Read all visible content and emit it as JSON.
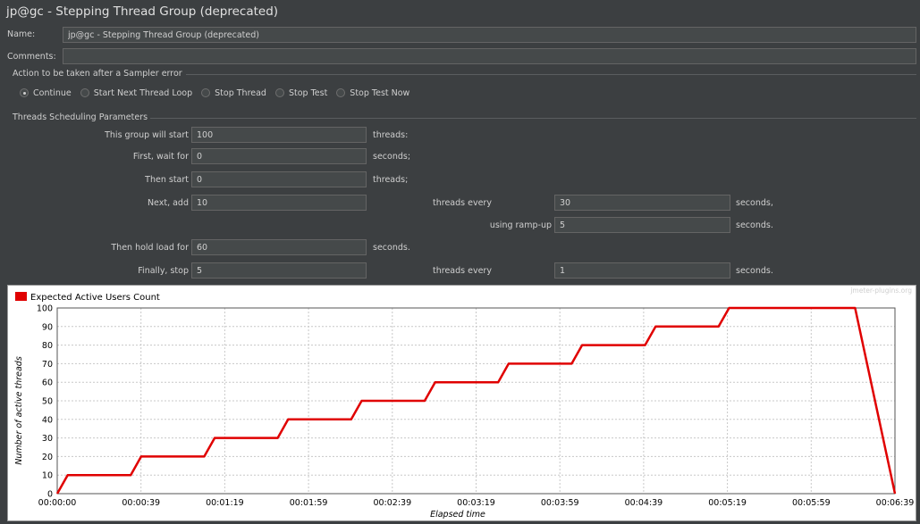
{
  "window": {
    "title": "jp@gc - Stepping Thread Group (deprecated)"
  },
  "name": {
    "label": "Name:",
    "value": "jp@gc - Stepping Thread Group (deprecated)"
  },
  "comments": {
    "label": "Comments:",
    "value": ""
  },
  "sampler_error": {
    "heading": "Action to be taken after a Sampler error",
    "options": [
      {
        "label": "Continue",
        "selected": true
      },
      {
        "label": "Start Next Thread Loop",
        "selected": false
      },
      {
        "label": "Stop Thread",
        "selected": false
      },
      {
        "label": "Stop Test",
        "selected": false
      },
      {
        "label": "Stop Test Now",
        "selected": false
      }
    ]
  },
  "scheduling": {
    "heading": "Threads Scheduling Parameters",
    "start": {
      "label": "This group will start",
      "value": "100",
      "unit": "threads:"
    },
    "wait": {
      "label": "First, wait for",
      "value": "0",
      "unit": "seconds;"
    },
    "then_start": {
      "label": "Then start",
      "value": "0",
      "unit": "threads;"
    },
    "next_add": {
      "label": "Next, add",
      "value": "10",
      "mid": "threads every",
      "value2": "30",
      "unit": "seconds,"
    },
    "ramp_up": {
      "label": "using ramp-up",
      "value": "5",
      "unit": "seconds."
    },
    "hold": {
      "label": "Then hold load for",
      "value": "60",
      "unit": "seconds."
    },
    "stop": {
      "label": "Finally, stop",
      "value": "5",
      "mid": "threads every",
      "value2": "1",
      "unit": "seconds."
    }
  },
  "chart_data": {
    "type": "line",
    "legend": "Expected Active Users Count",
    "watermark": "jmeter-plugins.org",
    "xlabel": "Elapsed time",
    "ylabel": "Number of active threads",
    "ylim": [
      0,
      100
    ],
    "xlim": [
      0,
      399
    ],
    "yticks": [
      0,
      10,
      20,
      30,
      40,
      50,
      60,
      70,
      80,
      90,
      100
    ],
    "xticks": [
      "00:00:00",
      "00:00:39",
      "00:01:19",
      "00:01:59",
      "00:02:39",
      "00:03:19",
      "00:03:59",
      "00:04:39",
      "00:05:19",
      "00:05:59",
      "00:06:39"
    ],
    "grid": true,
    "line_color": "#e00000",
    "series": [
      {
        "name": "Expected Active Users Count",
        "x": [
          0,
          5,
          35,
          40,
          70,
          75,
          105,
          110,
          140,
          145,
          175,
          180,
          210,
          215,
          245,
          250,
          280,
          285,
          315,
          320,
          380,
          399
        ],
        "y": [
          0,
          10,
          10,
          20,
          20,
          30,
          30,
          40,
          40,
          50,
          50,
          60,
          60,
          70,
          70,
          80,
          80,
          90,
          90,
          100,
          100,
          0
        ]
      }
    ]
  }
}
